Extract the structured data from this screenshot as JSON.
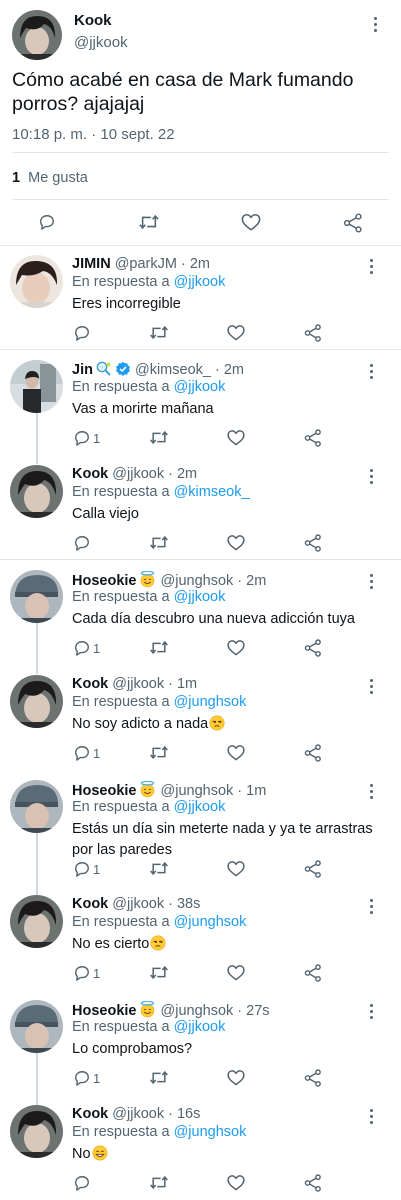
{
  "main_tweet": {
    "author": "Kook",
    "handle": "@jjkook",
    "text": "Cómo acabé en casa de Mark fumando porros? ajajajaj",
    "timestamp": "10:18 p. m. · 10 sept. 22",
    "likes_count": "1",
    "likes_label": "Me gusta"
  },
  "reply_prefix": "En respuesta a",
  "replies": [
    {
      "author": "JIMIN",
      "meta": "@parkJM · 2m",
      "mention": "@jjkook",
      "text": "Eres incorregible",
      "reply_count": ""
    },
    {
      "author": "Jin",
      "meta": "@kimseok_ · 2m",
      "mention": "@jjkook",
      "text": "Vas a morirte mañana",
      "reply_count": "1"
    },
    {
      "author": "Kook",
      "meta": "@jjkook · 2m",
      "mention": "@kimseok_",
      "text": "Calla viejo",
      "reply_count": ""
    },
    {
      "author": "Hoseokie",
      "meta": "@junghsok · 2m",
      "mention": "@jjkook",
      "text": "Cada día descubro una nueva adicción tuya",
      "reply_count": "1"
    },
    {
      "author": "Kook",
      "meta": "@jjkook · 1m",
      "mention": "@junghsok",
      "text": "No soy adicto a nada",
      "reply_count": "1"
    },
    {
      "author": "Hoseokie",
      "meta": "@junghsok · 1m",
      "mention": "@jjkook",
      "text": "Estás un día sin meterte nada y ya te arrastras por las paredes",
      "reply_count": "1"
    },
    {
      "author": "Kook",
      "meta": "@jjkook · 38s",
      "mention": "@junghsok",
      "text": "No es cierto",
      "reply_count": "1"
    },
    {
      "author": "Hoseokie",
      "meta": "@junghsok · 27s",
      "mention": "@jjkook",
      "text": "Lo comprobamos?",
      "reply_count": "1"
    },
    {
      "author": "Kook",
      "meta": "@jjkook · 16s",
      "mention": "@junghsok",
      "text": "No",
      "reply_count": ""
    }
  ],
  "icons": {
    "reply": "speech-bubble-icon",
    "retweet": "retweet-icon",
    "like": "heart-icon",
    "share": "share-icon",
    "more": "more-vertical-icon",
    "verified": "verified-badge-icon",
    "tennis": "tennis-racket-emoji",
    "halo": "smiling-face-with-halo-emoji",
    "unamused": "unamused-face-emoji",
    "grin": "grinning-face-emoji"
  },
  "colors": {
    "text": "#0f1419",
    "secondary": "#536471",
    "link": "#1d9bf0",
    "divider": "#e1e6ea"
  }
}
